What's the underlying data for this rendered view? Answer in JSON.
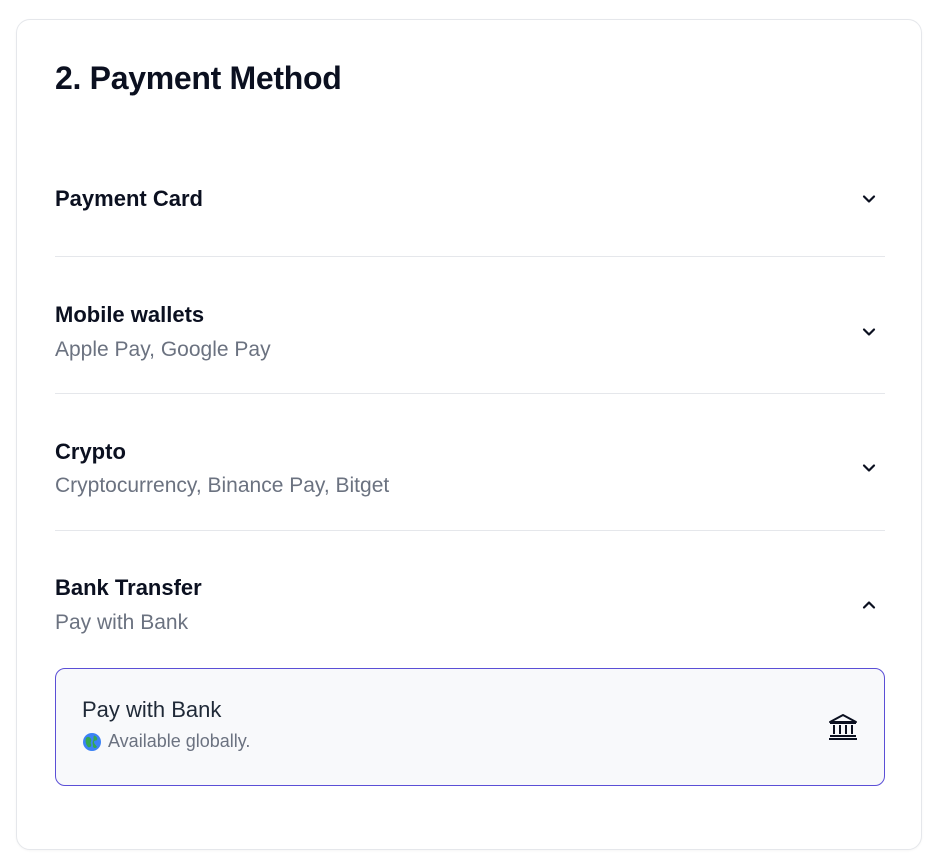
{
  "section_title": "2. Payment Method",
  "methods": [
    {
      "title": "Payment Card",
      "subtitle": "",
      "expanded": false
    },
    {
      "title": "Mobile wallets",
      "subtitle": "Apple Pay, Google Pay",
      "expanded": false
    },
    {
      "title": "Crypto",
      "subtitle": "Cryptocurrency, Binance Pay, Bitget",
      "expanded": false
    },
    {
      "title": "Bank Transfer",
      "subtitle": "Pay with Bank",
      "expanded": true
    }
  ],
  "bank_option": {
    "name": "Pay with Bank",
    "note": "Available globally.",
    "icon": "bank-icon",
    "note_icon": "globe-icon"
  },
  "colors": {
    "accent_border": "#5b4fd6",
    "muted_text": "#6b7280",
    "divider": "#e5e7eb"
  }
}
